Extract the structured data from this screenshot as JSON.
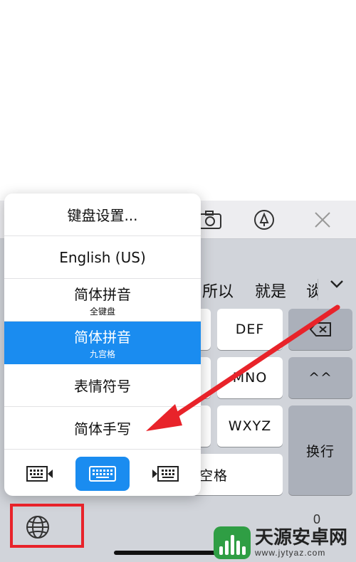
{
  "toolbar": {
    "icons": [
      "camera-icon",
      "marker-icon",
      "close-icon"
    ]
  },
  "candidates": [
    "所以",
    "就是",
    "谈"
  ],
  "keys": {
    "def": "DEF",
    "mno": "MNO",
    "wxyz": "WXYZ",
    "emoticon": "^^",
    "return": "换行",
    "space": "空格",
    "zero": "0"
  },
  "menu": {
    "items": [
      {
        "label": "键盘设置...",
        "sub": ""
      },
      {
        "label": "English (US)",
        "sub": ""
      },
      {
        "label": "简体拼音",
        "sub": "全键盘"
      },
      {
        "label": "简体拼音",
        "sub": "九宫格",
        "selected": true
      },
      {
        "label": "表情符号",
        "sub": ""
      },
      {
        "label": "简体手写",
        "sub": ""
      }
    ],
    "keyboard_modes": [
      "keyboard-left-icon",
      "keyboard-full-icon",
      "keyboard-right-icon"
    ],
    "active_mode": 1
  },
  "colors": {
    "accent": "#1a8cf0",
    "annotation": "#e8232a",
    "keyboard_bg": "#d1d4da"
  },
  "watermark": {
    "title": "天源安卓网",
    "url": "www.jytyaz.com"
  }
}
